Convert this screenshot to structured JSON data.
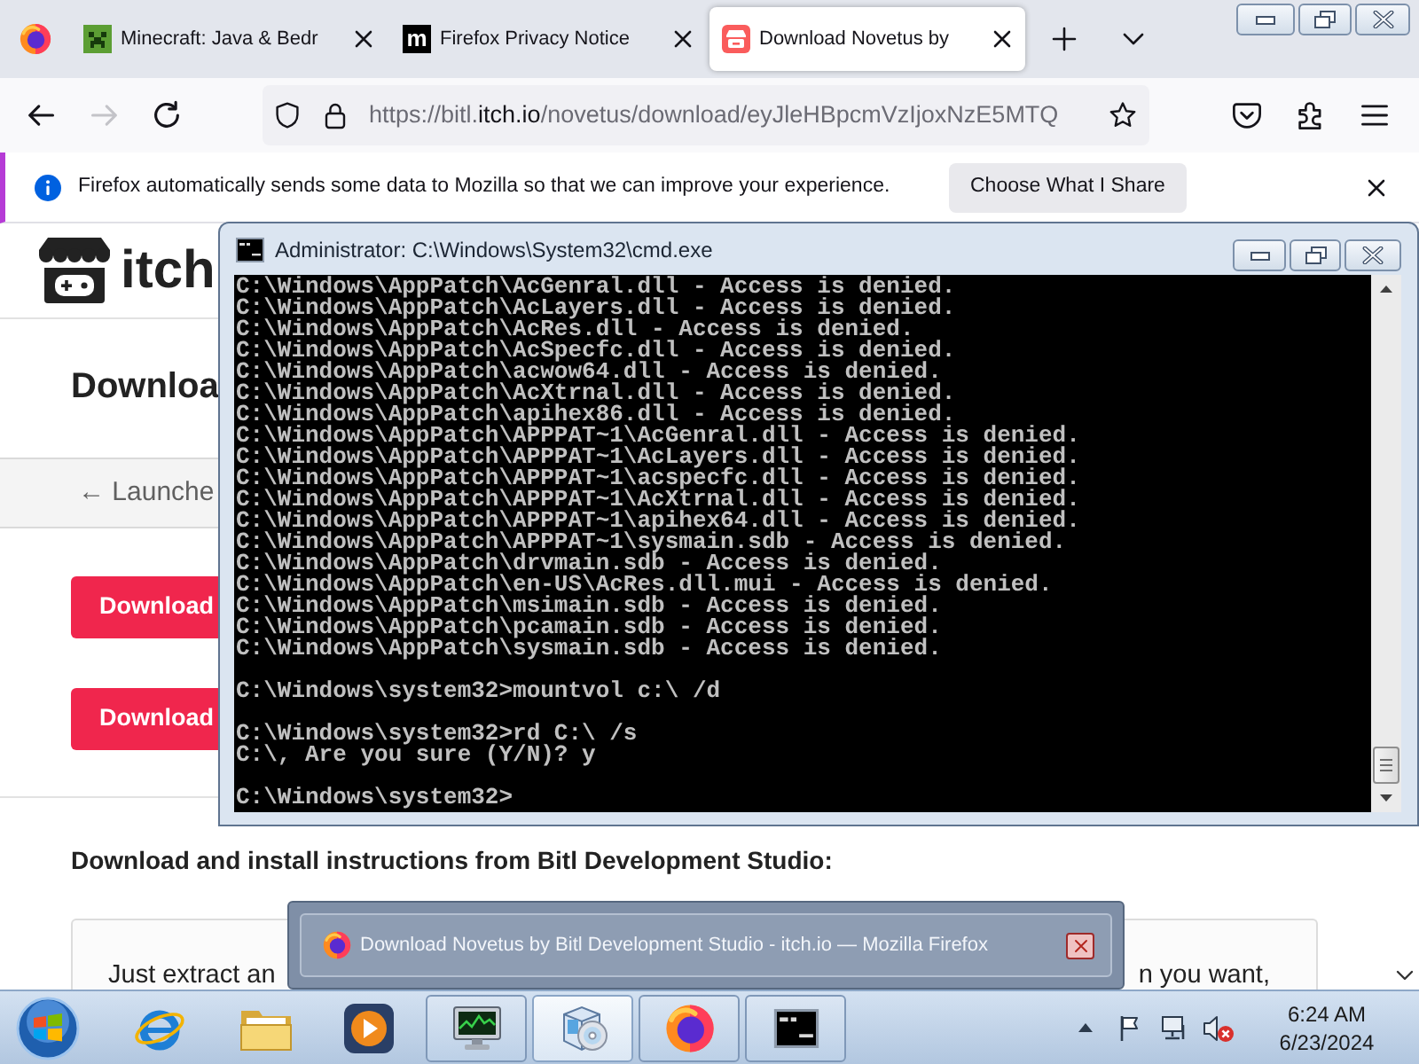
{
  "browser": {
    "tabs": [
      {
        "title": "Minecraft: Java & Bedr",
        "selected": false
      },
      {
        "title": "Firefox Privacy Notice",
        "favicon_letter": "m",
        "selected": false
      },
      {
        "title": "Download Novetus by",
        "selected": true
      }
    ],
    "nav_buttons": [
      {
        "disabled": false
      },
      {
        "disabled": true
      },
      {
        "disabled": false
      }
    ],
    "address": {
      "segments": [
        {
          "text": "https://bitl.",
          "emphasis": false
        },
        {
          "text": "itch.io",
          "emphasis": true
        },
        {
          "text": "/novetus/download/eyJleHBpcmVzIjoxNzE5MTQ",
          "emphasis": false
        }
      ]
    },
    "notification": {
      "message": "Firefox automatically sends some data to Mozilla so that we can improve your experience.",
      "button": "Choose What I Share"
    }
  },
  "page": {
    "logo_text": "itch",
    "heading": "Downloa",
    "back_link": "← Launche",
    "download_buttons": [
      "Download",
      "Download"
    ],
    "instructions_heading": "Download and install instructions from Bitl Development Studio:",
    "instructions_visible": [
      "Just extract an",
      "n you want,"
    ]
  },
  "console_window": {
    "title": "Administrator: C:\\Windows\\System32\\cmd.exe",
    "lines": [
      {
        "kind": "output",
        "text": "C:\\Windows\\AppPatch\\AcGenral.dll - Access is denied."
      },
      {
        "kind": "output",
        "text": "C:\\Windows\\AppPatch\\AcLayers.dll - Access is denied."
      },
      {
        "kind": "output",
        "text": "C:\\Windows\\AppPatch\\AcRes.dll - Access is denied."
      },
      {
        "kind": "output",
        "text": "C:\\Windows\\AppPatch\\AcSpecfc.dll - Access is denied."
      },
      {
        "kind": "output",
        "text": "C:\\Windows\\AppPatch\\acwow64.dll - Access is denied."
      },
      {
        "kind": "output",
        "text": "C:\\Windows\\AppPatch\\AcXtrnal.dll - Access is denied."
      },
      {
        "kind": "output",
        "text": "C:\\Windows\\AppPatch\\apihex86.dll - Access is denied."
      },
      {
        "kind": "output",
        "text": "C:\\Windows\\AppPatch\\APPPAT~1\\AcGenral.dll - Access is denied."
      },
      {
        "kind": "output",
        "text": "C:\\Windows\\AppPatch\\APPPAT~1\\AcLayers.dll - Access is denied."
      },
      {
        "kind": "output",
        "text": "C:\\Windows\\AppPatch\\APPPAT~1\\acspecfc.dll - Access is denied."
      },
      {
        "kind": "output",
        "text": "C:\\Windows\\AppPatch\\APPPAT~1\\AcXtrnal.dll - Access is denied."
      },
      {
        "kind": "output",
        "text": "C:\\Windows\\AppPatch\\APPPAT~1\\apihex64.dll - Access is denied."
      },
      {
        "kind": "output",
        "text": "C:\\Windows\\AppPatch\\APPPAT~1\\sysmain.sdb - Access is denied."
      },
      {
        "kind": "output",
        "text": "C:\\Windows\\AppPatch\\drvmain.sdb - Access is denied."
      },
      {
        "kind": "output",
        "text": "C:\\Windows\\AppPatch\\en-US\\AcRes.dll.mui - Access is denied."
      },
      {
        "kind": "output",
        "text": "C:\\Windows\\AppPatch\\msimain.sdb - Access is denied."
      },
      {
        "kind": "output",
        "text": "C:\\Windows\\AppPatch\\pcamain.sdb - Access is denied."
      },
      {
        "kind": "output",
        "text": "C:\\Windows\\AppPatch\\sysmain.sdb - Access is denied."
      },
      {
        "kind": "prompt",
        "text": "C:\\Windows\\system32>mountvol c:\\ /d"
      },
      {
        "kind": "prompt",
        "text": "C:\\Windows\\system32>rd C:\\ /s"
      },
      {
        "kind": "output",
        "text": "C:\\, Are you sure (Y/N)? y"
      },
      {
        "kind": "prompt",
        "text": "C:\\Windows\\system32>"
      }
    ]
  },
  "taskbar_preview": {
    "title": "Download Novetus by Bitl Development Studio - itch.io — Mozilla Firefox"
  },
  "taskbar": {
    "running_apps": [
      {
        "highlighted": false
      },
      {
        "highlighted": true
      },
      {
        "highlighted": false
      },
      {
        "highlighted": false
      }
    ],
    "tray": {
      "volume_muted": true
    },
    "clock": {
      "time": "6:24 AM",
      "date": "6/23/2024"
    }
  }
}
